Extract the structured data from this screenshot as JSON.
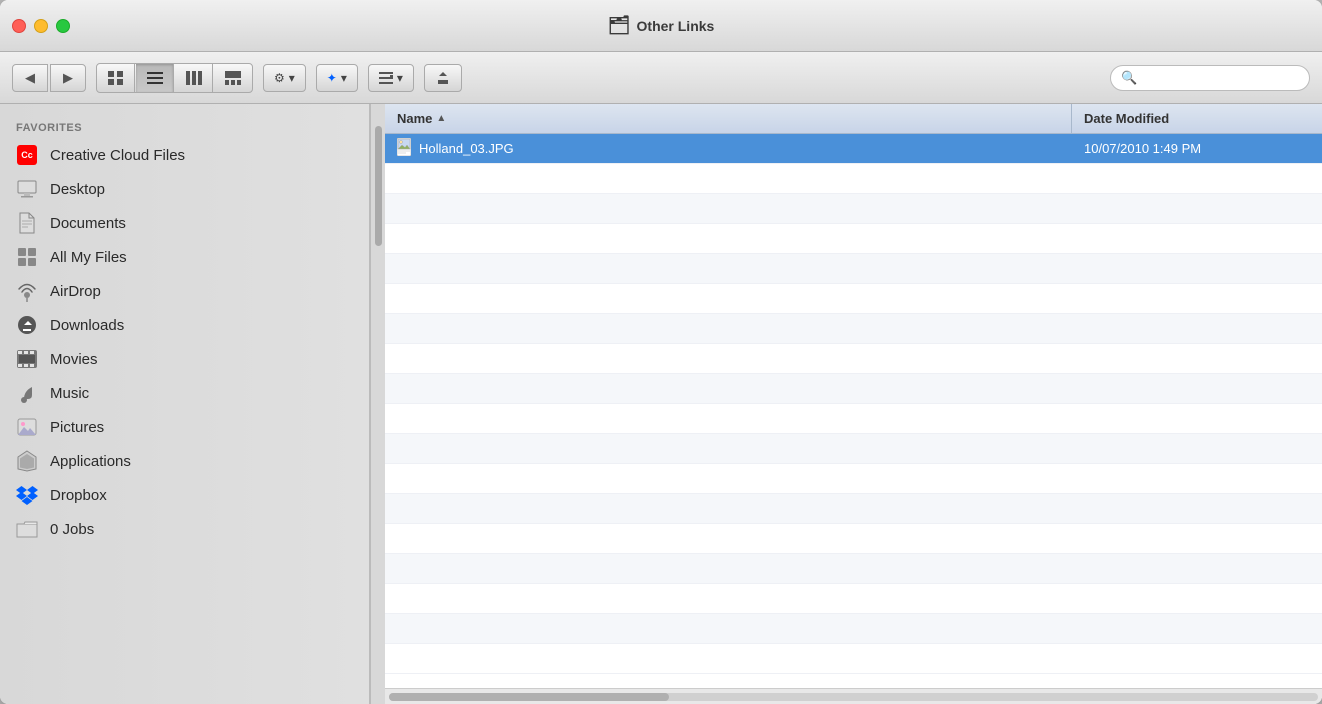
{
  "window": {
    "title": "Other Links",
    "traffic_lights": {
      "close": "close",
      "minimize": "minimize",
      "maximize": "maximize"
    }
  },
  "toolbar": {
    "nav_back_label": "◀",
    "nav_forward_label": "▶",
    "view_icon_label": "⊞",
    "view_list_label": "☰",
    "view_column_label": "▥",
    "view_cover_label": "▦",
    "action_label": "⚙",
    "action_arrow": "▾",
    "dropbox_label": "◈",
    "dropbox_arrow": "▾",
    "arrange_label": "⊞",
    "arrange_arrow": "▾",
    "share_label": "↗",
    "search_placeholder": ""
  },
  "sidebar": {
    "section_label": "FAVORITES",
    "items": [
      {
        "id": "creative-cloud-files",
        "label": "Creative Cloud Files",
        "icon": "cc"
      },
      {
        "id": "desktop",
        "label": "Desktop",
        "icon": "desktop"
      },
      {
        "id": "documents",
        "label": "Documents",
        "icon": "doc"
      },
      {
        "id": "all-my-files",
        "label": "All My Files",
        "icon": "grid"
      },
      {
        "id": "airdrop",
        "label": "AirDrop",
        "icon": "airdrop"
      },
      {
        "id": "downloads",
        "label": "Downloads",
        "icon": "download"
      },
      {
        "id": "movies",
        "label": "Movies",
        "icon": "movies"
      },
      {
        "id": "music",
        "label": "Music",
        "icon": "music"
      },
      {
        "id": "pictures",
        "label": "Pictures",
        "icon": "pictures"
      },
      {
        "id": "applications",
        "label": "Applications",
        "icon": "rocket"
      },
      {
        "id": "dropbox",
        "label": "Dropbox",
        "icon": "dropbox"
      },
      {
        "id": "jobs",
        "label": "0 Jobs",
        "icon": "folder"
      }
    ]
  },
  "file_list": {
    "columns": {
      "name": "Name",
      "date_modified": "Date Modified"
    },
    "sort_indicator": "▲",
    "rows": [
      {
        "id": "holland-03",
        "name": "Holland_03.JPG",
        "icon": "image",
        "date_modified": "10/07/2010 1:49 PM",
        "selected": true
      }
    ]
  }
}
